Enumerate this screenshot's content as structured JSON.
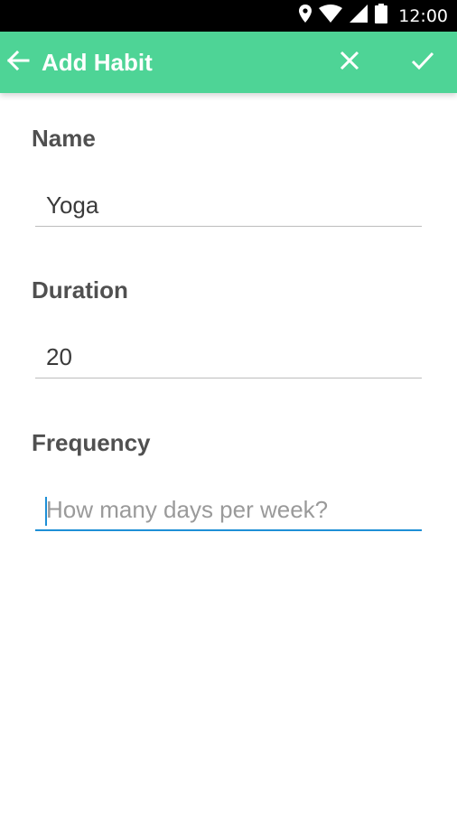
{
  "status_bar": {
    "time": "12:00",
    "icons": [
      "location-icon",
      "wifi-icon",
      "signal-icon",
      "battery-icon"
    ]
  },
  "app_bar": {
    "title": "Add Habit",
    "background_color": "#4ed496",
    "icons": {
      "back": "arrow-back-icon",
      "close": "close-icon",
      "confirm": "check-icon"
    }
  },
  "form": {
    "name": {
      "label": "Name",
      "value": "Yoga"
    },
    "duration": {
      "label": "Duration",
      "value": "20"
    },
    "frequency": {
      "label": "Frequency",
      "value": "",
      "placeholder": "How many days per week?",
      "focused": true
    }
  },
  "colors": {
    "accent": "#1e8fd6",
    "label_text": "#505050",
    "input_text": "#3a3a3a"
  }
}
